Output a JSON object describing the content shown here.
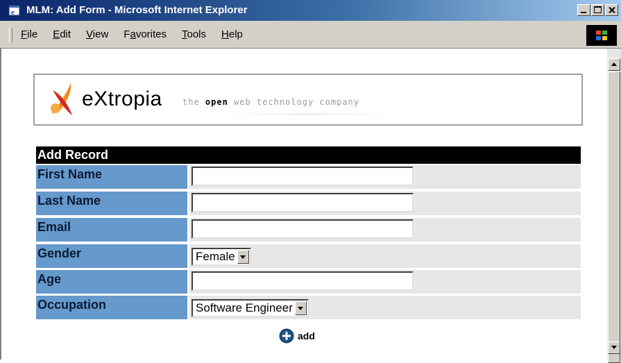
{
  "window": {
    "title": "MLM: Add Form - Microsoft Internet Explorer",
    "icon": "ie-icon",
    "buttons": [
      "minimize-icon",
      "maximize-icon",
      "close-icon"
    ]
  },
  "menu": {
    "items": [
      {
        "label": "File",
        "accel": "F",
        "rest": "ile"
      },
      {
        "label": "Edit",
        "accel": "E",
        "rest": "dit"
      },
      {
        "label": "View",
        "accel": "V",
        "rest": "iew"
      },
      {
        "label": "Favorites",
        "pre": "F",
        "accel": "a",
        "rest": "vorites"
      },
      {
        "label": "Tools",
        "accel": "T",
        "rest": "ools"
      },
      {
        "label": "Help",
        "accel": "H",
        "rest": "elp"
      }
    ],
    "throbber_icon": "windows-logo-icon"
  },
  "banner": {
    "logo_text": "eXtropia",
    "tagline_before": "the ",
    "tagline_bold": "open",
    "tagline_after": " web technology company",
    "logo_colors": {
      "orange": "#f28c1e",
      "red": "#d42a1c"
    }
  },
  "form": {
    "header": "Add Record",
    "fields": [
      {
        "label": "First Name",
        "type": "text",
        "value": ""
      },
      {
        "label": "Last Name",
        "type": "text",
        "value": ""
      },
      {
        "label": "Email",
        "type": "text",
        "value": ""
      },
      {
        "label": "Gender",
        "type": "select",
        "value": "Female"
      },
      {
        "label": "Age",
        "type": "text",
        "value": ""
      },
      {
        "label": "Occupation",
        "type": "select",
        "value": "Software Engineer"
      }
    ],
    "submit_label": "add",
    "submit_icon": "plus-circle-icon"
  },
  "colors": {
    "label_bg": "#6699cc",
    "value_bg": "#e7e7e7",
    "header_bg": "#000000"
  }
}
